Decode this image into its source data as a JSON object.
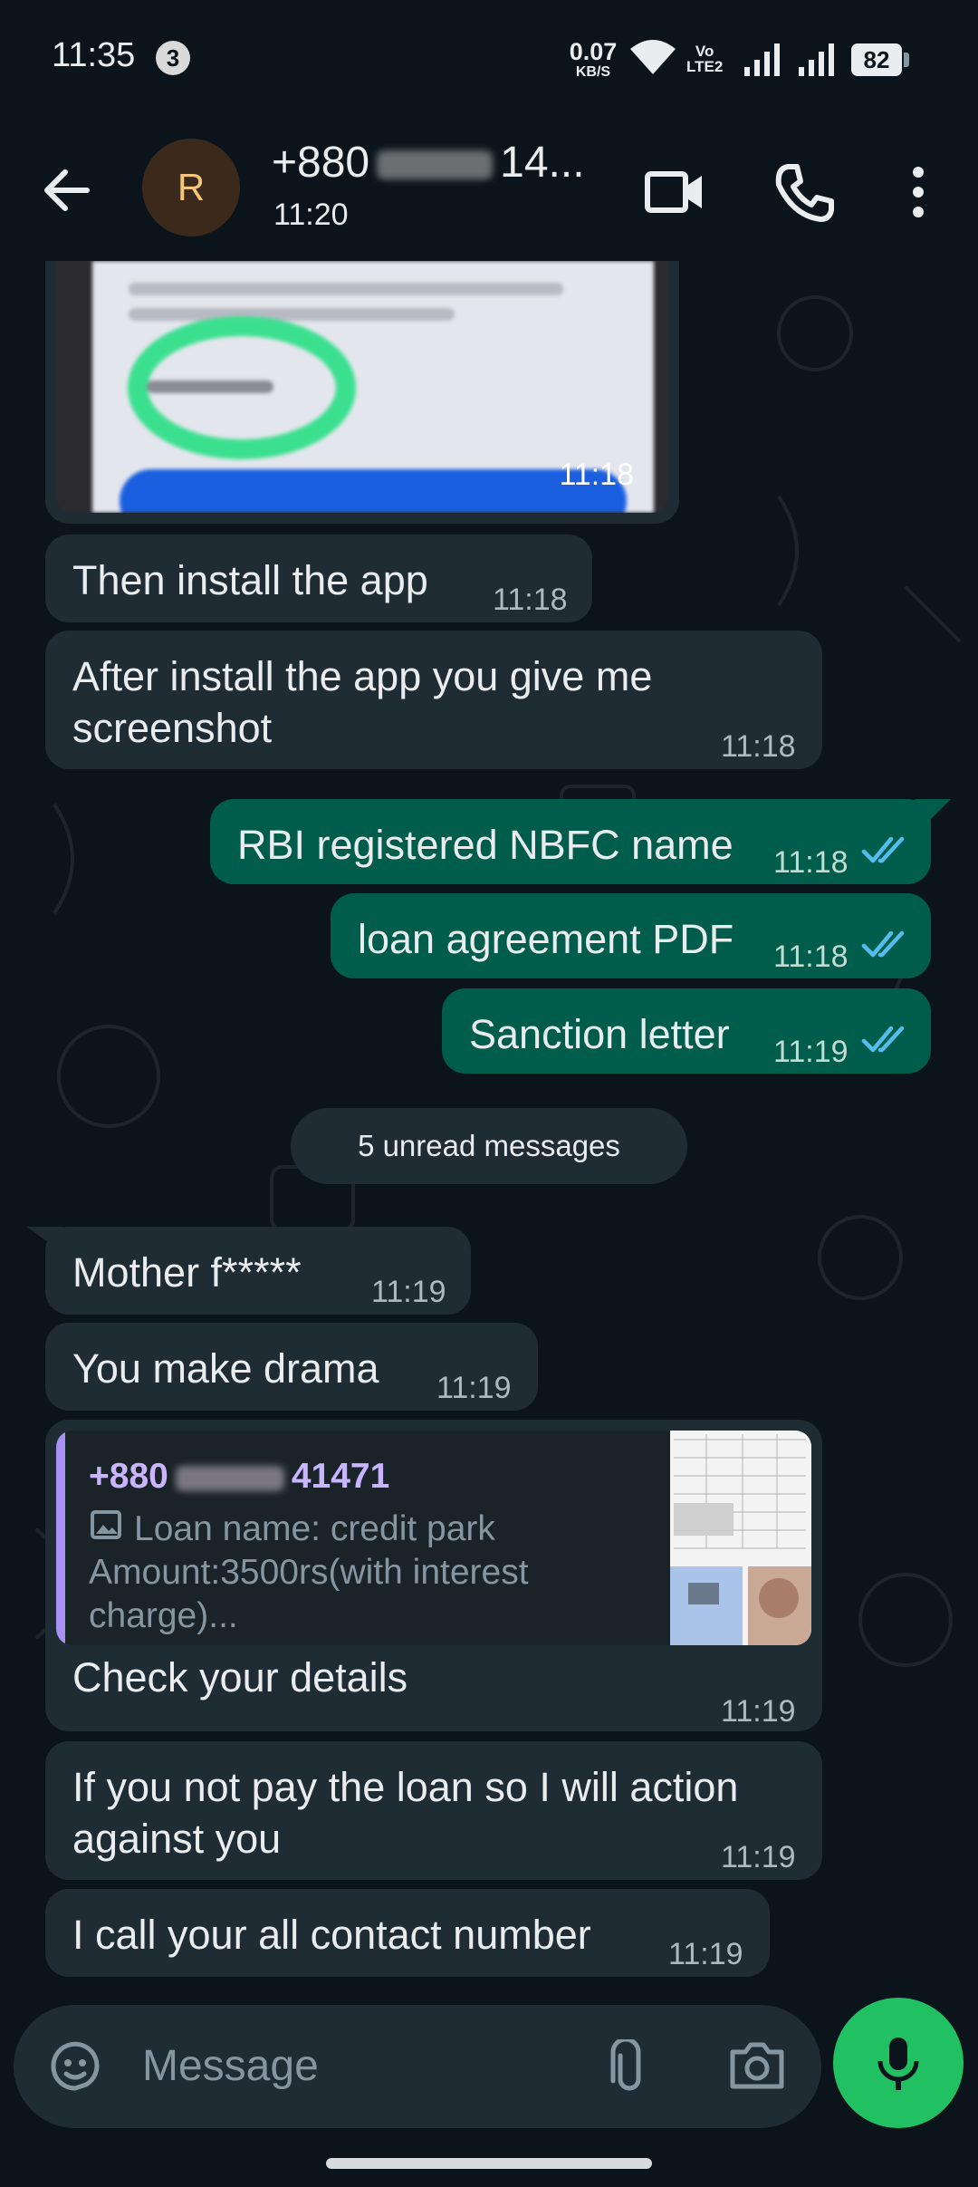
{
  "status_bar": {
    "time": "11:35",
    "notification_count": "3",
    "net_speed_value": "0.07",
    "net_speed_unit": "KB/S",
    "volte_line1": "Vo",
    "volte_line2": "LTE2",
    "battery": "82"
  },
  "header": {
    "avatar_initial": "R",
    "contact_prefix": "+880",
    "contact_suffix": "14...",
    "subtitle": "11:20"
  },
  "messages": [
    {
      "dir": "in",
      "kind": "image",
      "time": "11:18"
    },
    {
      "dir": "in",
      "text": "Then install the app",
      "time": "11:18"
    },
    {
      "dir": "in",
      "text_lines": [
        "After install the app you give me",
        "screenshot"
      ],
      "time": "11:18"
    },
    {
      "dir": "out",
      "text": "RBI registered NBFC name",
      "time": "11:18",
      "status": "read"
    },
    {
      "dir": "out",
      "text": "loan agreement PDF",
      "time": "11:18",
      "status": "read"
    },
    {
      "dir": "out",
      "text": "Sanction letter",
      "time": "11:19",
      "status": "read"
    },
    {
      "dir": "in",
      "text": "Mother f*****",
      "time": "11:19"
    },
    {
      "dir": "in",
      "text": "You make drama",
      "time": "11:19"
    },
    {
      "dir": "in",
      "kind": "reply",
      "quote_name_prefix": "+880",
      "quote_name_suffix": "41471",
      "quote_lines": [
        "Loan name: credit park",
        "Amount:3500rs(with interest",
        "charge)..."
      ],
      "text": "Check your details",
      "time": "11:19"
    },
    {
      "dir": "in",
      "text_lines": [
        "If you not pay the loan so I will action",
        "against you"
      ],
      "time": "11:19"
    },
    {
      "dir": "in",
      "text": "I call your all contact number",
      "time": "11:19"
    }
  ],
  "unread_banner": "5 unread messages",
  "composer": {
    "placeholder": "Message",
    "icons": [
      "sticker-icon",
      "attach-icon",
      "camera-icon",
      "mic-icon"
    ]
  },
  "colors": {
    "background": "#0b141a",
    "incoming_bubble": "#202c33",
    "outgoing_bubble": "#005c4b",
    "read_ticks": "#53bdeb",
    "mic_button": "#21c063"
  }
}
